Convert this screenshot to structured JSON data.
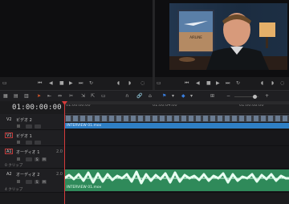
{
  "timeline": {
    "timecode": "01:00:00:00",
    "ruler_ticks": [
      "01:00:00:00",
      "01:00:04:00",
      "01:00:08:00"
    ],
    "tracks": [
      {
        "id": "V2",
        "name": "ビデオ 2",
        "clip": ""
      },
      {
        "id": "V1",
        "name": "ビデオ 1",
        "clip": "INTERVIEW 01.mov",
        "clip_name": "INTERVIEW 01.mov"
      },
      {
        "id": "A1",
        "name": "オーディオ 1",
        "channel": "2.0",
        "clip_count": "0 クリップ"
      },
      {
        "id": "A2",
        "name": "オーディオ 2",
        "channel": "2.0",
        "clip_count": "4 クリップ",
        "clip_name": "INTERVIEW 01.mov"
      }
    ]
  },
  "colors": {
    "video_clip": "#2f7fc4",
    "audio_clip": "#2f8a5a",
    "playhead": "#d43b3b",
    "accent_blue": "#3a7fe0"
  }
}
